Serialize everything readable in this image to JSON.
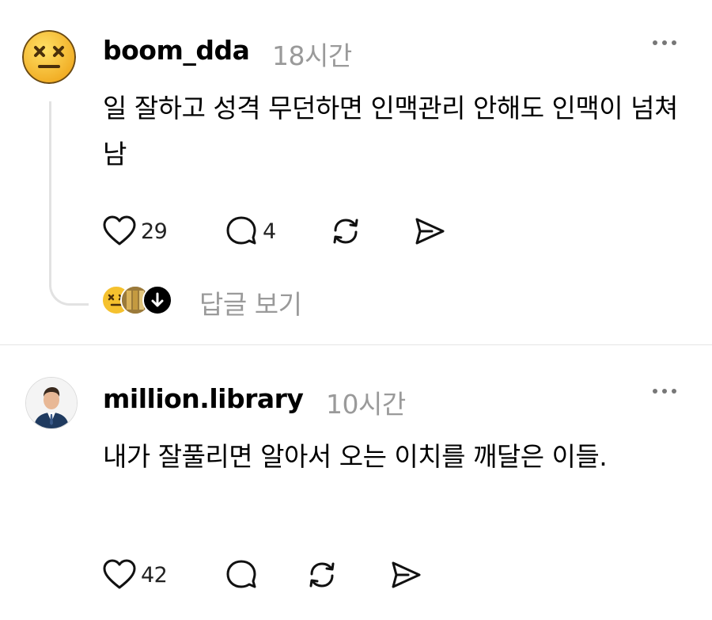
{
  "posts": [
    {
      "username": "boom_dda",
      "timestamp": "18시간",
      "body": "일 잘하고 성격 무던하면 인맥관리 안해도 인맥이 넘쳐남",
      "likes": "29",
      "comments": "4",
      "avatar_icon": "dizzy-face-emoji-icon",
      "view_replies_label": "답글 보기"
    },
    {
      "username": "million.library",
      "timestamp": "10시간",
      "body": "내가 잘풀리면 알아서 오는 이치를 깨달은 이들.",
      "likes": "42",
      "avatar_icon": "man-in-suit-avatar-icon"
    }
  ],
  "icons": {
    "like": "heart-icon",
    "comment": "speech-bubble-icon",
    "repost": "repost-arrows-icon",
    "share": "paper-plane-icon",
    "more": "ellipsis-icon",
    "down": "arrow-down-icon"
  },
  "colors": {
    "text": "#000000",
    "muted": "#9a9a9a",
    "divider": "#e4e4e4",
    "emoji": "#f7c531"
  }
}
